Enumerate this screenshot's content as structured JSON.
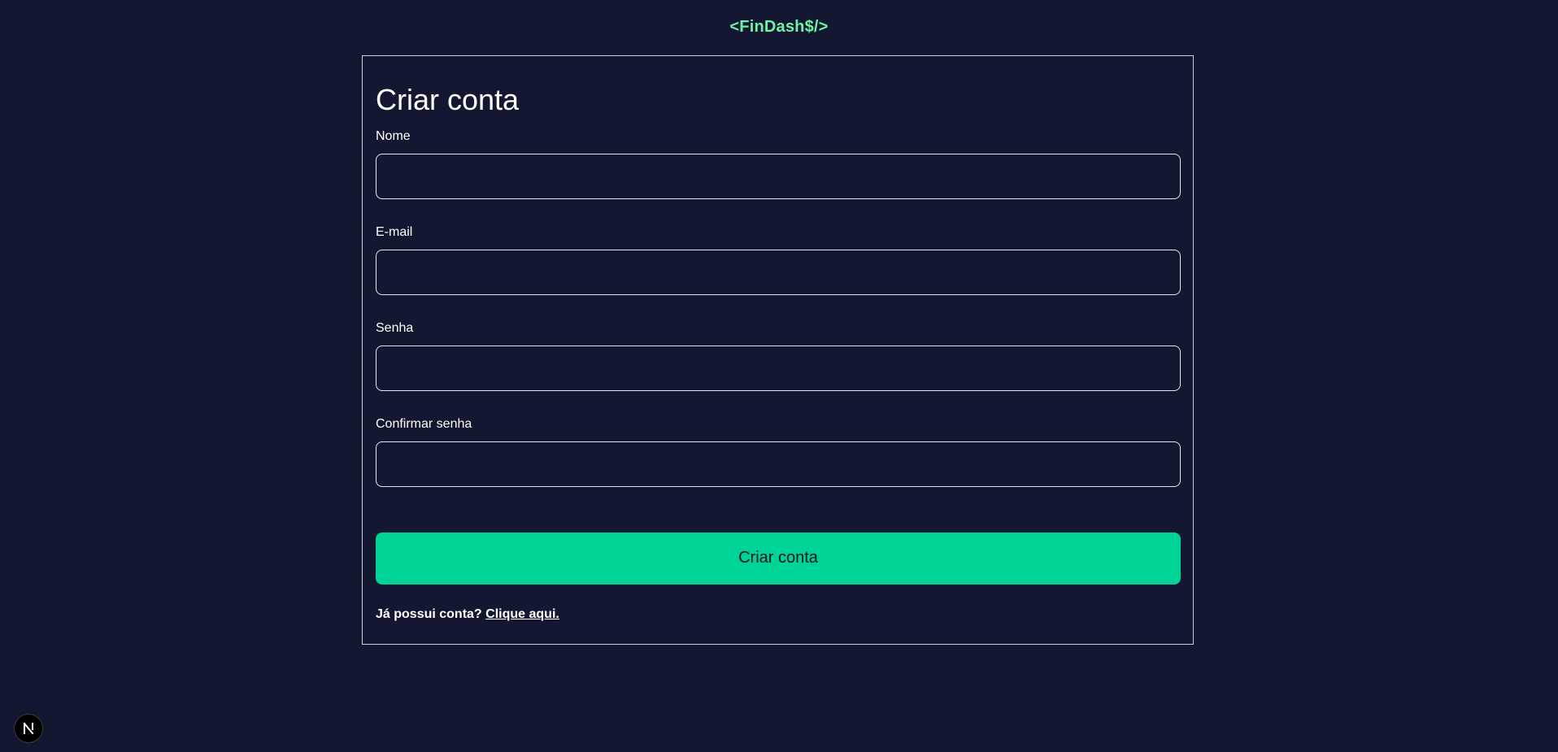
{
  "brand": {
    "logo_text": "<FinDash$/>"
  },
  "form": {
    "title": "Criar conta",
    "fields": [
      {
        "label": "Nome",
        "value": "",
        "placeholder": ""
      },
      {
        "label": "E-mail",
        "value": "",
        "placeholder": ""
      },
      {
        "label": "Senha",
        "value": "",
        "placeholder": ""
      },
      {
        "label": "Confirmar senha",
        "value": "",
        "placeholder": ""
      }
    ],
    "submit_label": "Criar conta",
    "login_prompt": "Já possui conta?",
    "login_link": "Clique aqui."
  },
  "colors": {
    "background": "#141731",
    "accent": "#00d396",
    "brand": "#6ef2a4"
  },
  "badge": {
    "icon": "nextjs-icon"
  }
}
